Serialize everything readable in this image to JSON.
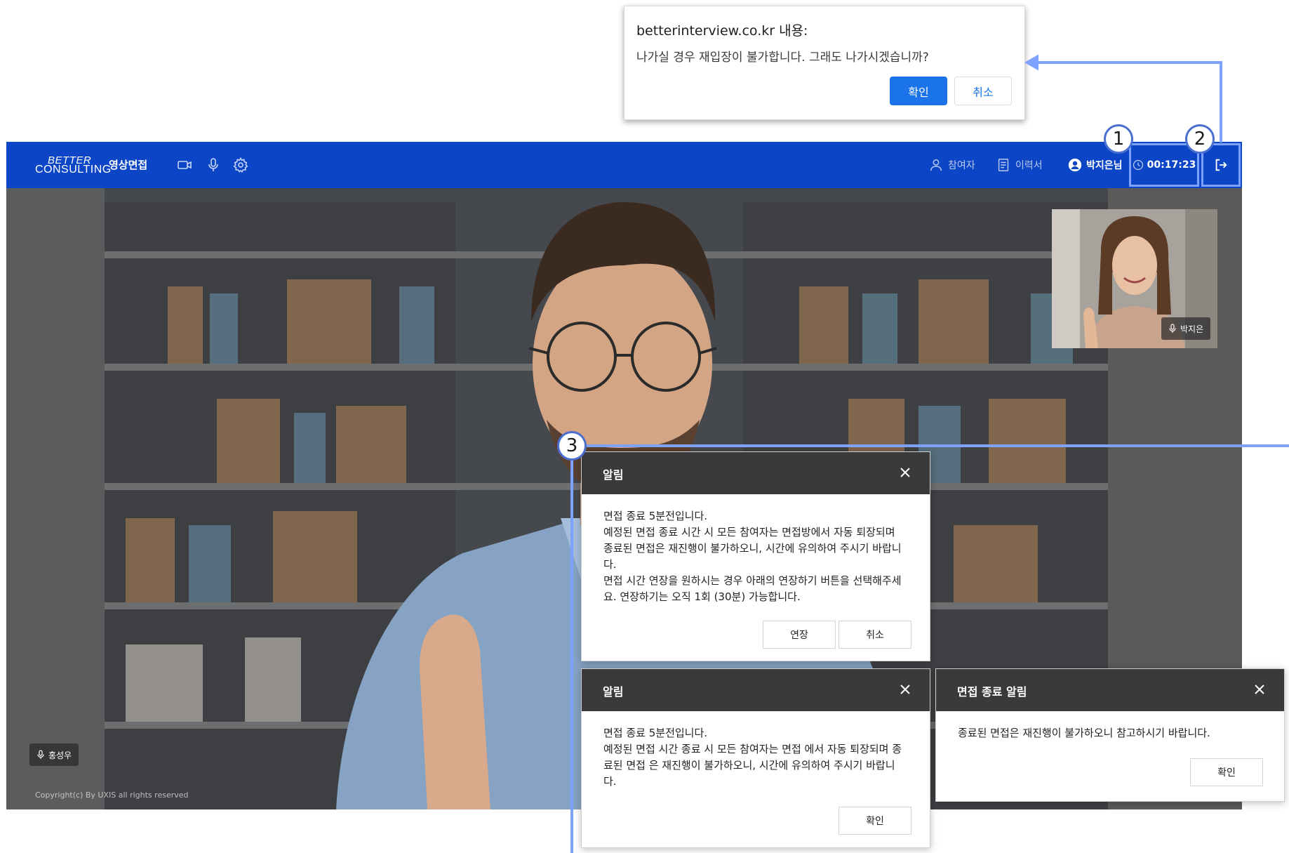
{
  "browser_dialog": {
    "origin": "betterinterview.co.kr 내용:",
    "message": "나가실 경우 재입장이 불가합니다. 그래도 나가시겠습니까?",
    "ok_label": "확인",
    "cancel_label": "취소",
    "accent": "#1a73e8"
  },
  "topbar": {
    "logo_line1": "BETTER",
    "logo_line2": "CONSULTING",
    "app_name": "영상면접",
    "icons": [
      "camera-icon",
      "microphone-icon",
      "settings-icon"
    ],
    "participants_label": "참여자",
    "resume_label": "이력서",
    "user_name": "박지은님",
    "timer": "00:17:23",
    "exit_icon": "exit-icon",
    "background": "#0c46c6"
  },
  "video": {
    "main_speaker": "홍성우",
    "pip_speaker": "박지은",
    "copyright": "Copyright(c) By UXIS all rights reserved"
  },
  "modals": {
    "extend": {
      "title": "알림",
      "lines": [
        "면접 종료 5분전입니다.",
        "예정된 면접 종료 시간 시 모든 참여자는 면접방에서 자동 퇴장되며",
        "종료된 면접은 재진행이 불가하오니, 시간에 유의하여 주시기 바랍니",
        "다.",
        "면접 시간 연장을 원하시는 경우 아래의 연장하기 버튼을 선택해주세",
        "요. 연장하기는 오직 1회 (30분) 가능합니다."
      ],
      "extend_label": "연장",
      "cancel_label": "취소"
    },
    "warning": {
      "title": "알림",
      "lines": [
        "면접 종료 5분전입니다.",
        "예정된 면접 시간 종료 시 모든 참여자는 면접 에서 자동 퇴장되며 종",
        "료된 면접 은 재진행이 불가하오니, 시간에 유의하여 주시기 바랍니",
        "다."
      ],
      "ok_label": "확인"
    },
    "ended": {
      "title": "면접 종료 알림",
      "message": "종료된 면접은 재진행이 불가하오니 참고하시기 바랍니다.",
      "ok_label": "확인"
    }
  },
  "callouts": [
    "1",
    "2",
    "3"
  ],
  "callout_color": "#7ea2ff"
}
